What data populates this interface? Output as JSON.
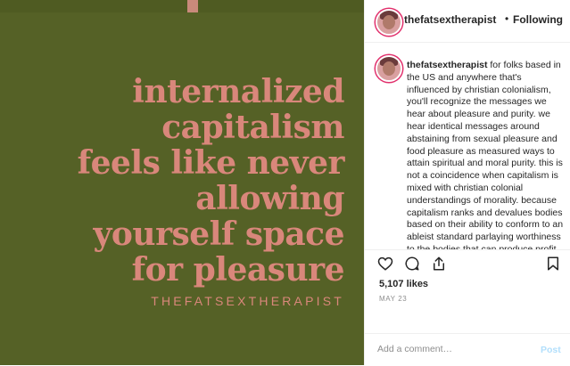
{
  "post": {
    "quote_lines": [
      "internalized",
      "capitalism",
      "feels like never",
      "allowing",
      "yourself space",
      "for pleasure"
    ],
    "signature": "THEFATSEXTHERAPIST",
    "colors": {
      "background": "#556126",
      "text": "#d9877b"
    }
  },
  "header": {
    "username": "thefatsextherapist",
    "separator": "•",
    "follow_status": "Following"
  },
  "caption": {
    "username": "thefatsextherapist",
    "text": "for folks based in the US and anywhere that's influenced by christian colonialism, you'll recognize the messages we hear about pleasure and purity. we hear identical messages around abstaining from sexual pleasure and food pleasure as measured ways to attain spiritual and moral purity. this is not a coincidence when capitalism is mixed with christian colonial understandings of morality. because capitalism ranks and devalues bodies based on their ability to conform to an ableist standard parlaying worthiness to the bodies that can produce profit under capitalism. christianity when used for the purposes of colonialism, also ranks and devalues bodies based on their purity and"
  },
  "actions": {
    "icons": [
      "heart-icon",
      "comment-icon",
      "share-icon",
      "bookmark-icon"
    ]
  },
  "likes": "5,107 likes",
  "date": "MAY 23",
  "comment": {
    "placeholder": "Add a comment…",
    "post_label": "Post"
  }
}
